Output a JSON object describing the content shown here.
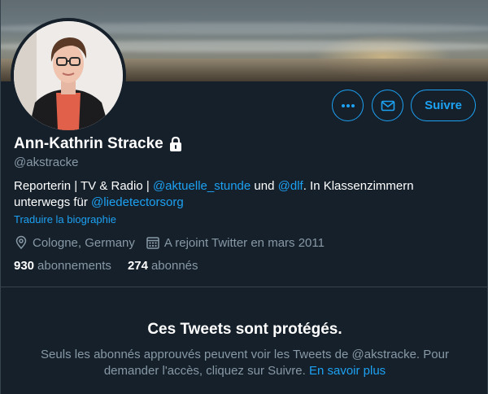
{
  "profile": {
    "display_name": "Ann-Kathrin Stracke",
    "handle": "@akstracke",
    "bio": {
      "part1": "Reporterin | TV & Radio | ",
      "mention1": "@aktuelle_stunde",
      "part2": " und ",
      "mention2": "@dlf",
      "part3": ". In Klassenzimmern unterwegs für ",
      "mention3": "@liedetectorsorg"
    },
    "translate_label": "Traduire la biographie",
    "location": "Cologne, Germany",
    "joined": "A rejoint Twitter en mars 2011",
    "following_count": "930",
    "following_label": "abonnements",
    "followers_count": "274",
    "followers_label": "abonnés"
  },
  "actions": {
    "more_icon": "more-dots-icon",
    "message_icon": "envelope-icon",
    "follow_label": "Suivre"
  },
  "protected": {
    "title": "Ces Tweets sont protégés.",
    "text": "Seuls les abonnés approuvés peuvent voir les Tweets de @akstracke. Pour demander l'accès, cliquez sur Suivre.",
    "learn_more": "En savoir plus"
  },
  "colors": {
    "background": "#15202b",
    "accent": "#1da1f2",
    "secondary_text": "#8899a6",
    "border": "#38444d"
  }
}
